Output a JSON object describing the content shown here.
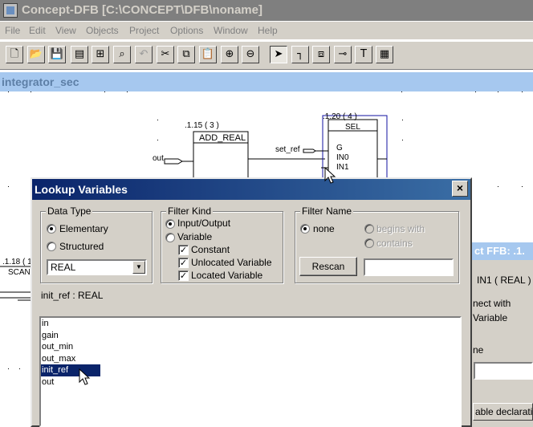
{
  "app": {
    "title": "Concept-DFB [C:\\CONCEPT\\DFB\\noname]",
    "menu": [
      "File",
      "Edit",
      "View",
      "Objects",
      "Project",
      "Options",
      "Window",
      "Help"
    ],
    "toolbar_icons": [
      "new-icon",
      "open-icon",
      "save-icon",
      "properties-icon",
      "tree-icon",
      "find-icon",
      "undo-icon",
      "cut-icon",
      "copy-icon",
      "paste-icon",
      "zoom-in-icon",
      "zoom-out-icon",
      "select-pointer-icon",
      "link-icon",
      "ffb-icon",
      "connector-icon",
      "text-icon",
      "grid-icon"
    ]
  },
  "document": {
    "title": "integrator_sec",
    "blocks": [
      {
        "id": ".1.15 ( 3 )",
        "name": "ADD_REAL"
      },
      {
        "id": ".1.20 ( 4 )",
        "name": "SEL",
        "pins": [
          "G",
          "IN0",
          "IN1"
        ]
      },
      {
        "id": ".1.18 ( 1",
        "name": "SCAN"
      }
    ],
    "wire_labels": [
      "out",
      "set_ref"
    ]
  },
  "background_dialog": {
    "title": "ct FFB: .1.",
    "text1": "IN1 ( REAL )",
    "text2": "nect with",
    "text3": "Variable",
    "text4": "ne",
    "text5": "able declaratio"
  },
  "lookup_dialog": {
    "title": "Lookup Variables",
    "close": "×",
    "data_type": {
      "label": "Data Type",
      "options": [
        {
          "label": "Elementary",
          "checked": true
        },
        {
          "label": "Structured",
          "checked": false
        }
      ],
      "selected": "REAL"
    },
    "filter_kind": {
      "label": "Filter Kind",
      "options": [
        {
          "label": "Input/Output",
          "checked": true
        },
        {
          "label": "Variable",
          "checked": false
        }
      ],
      "checkboxes": [
        {
          "label": "Constant",
          "checked": true
        },
        {
          "label": "Unlocated Variable",
          "checked": true
        },
        {
          "label": "Located Variable",
          "checked": true
        }
      ]
    },
    "filter_name": {
      "label": "Filter Name",
      "options": [
        {
          "label": "none",
          "checked": true
        },
        {
          "label": "begins with",
          "checked": false,
          "disabled": true
        },
        {
          "label": "contains",
          "checked": false,
          "disabled": true
        }
      ],
      "rescan": "Rescan",
      "value": ""
    },
    "info": "init_ref : REAL",
    "variables": [
      "in",
      "gain",
      "out_min",
      "out_max",
      "init_ref",
      "out"
    ],
    "selected_variable": "init_ref"
  }
}
